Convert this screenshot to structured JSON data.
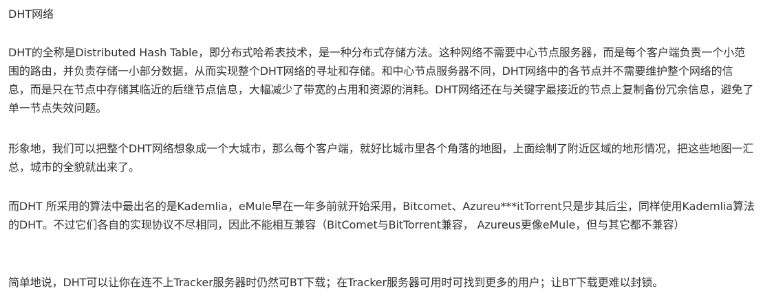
{
  "article": {
    "title": "DHT网络",
    "paragraphs": [
      "DHT的全称是Distributed Hash Table，即分布式哈希表技术，是一种分布式存储方法。这种网络不需要中心节点服务器，而是每个客户端负责一个小范围的路由，并负责存储一小部分数据，从而实现整个DHT网络的寻址和存储。和中心节点服务器不同，DHT网络中的各节点并不需要维护整个网络的信息，而是只在节点中存储其临近的后继节点信息，大幅减少了带宽的占用和资源的消耗。DHT网络还在与关键字最接近的节点上复制备份冗余信息，避免了单一节点失效问题。",
      "形象地，我们可以把整个DHT网络想象成一个大城市，那么每个客户端，就好比城市里各个角落的地图，上面绘制了附近区域的地形情况，把这些地图一汇总，城市的全貌就出来了。",
      "而DHT 所采用的算法中最出名的是Kademlia，eMule早在一年多前就开始采用，Bitcomet、Azureu***itTorrent只是步其后尘，同样使用Kademlia算法的DHT。不过它们各自的实现协议不尽相同，因此不能相互兼容（BitComet与BitTorrent兼容， Azureus更像eMule，但与其它都不兼容）",
      "简单地说，DHT可以让你在连不上Tracker服务器时仍然可BT下载；在Tracker服务器可用时可找到更多的用户；让BT下载更难以封锁。"
    ]
  }
}
